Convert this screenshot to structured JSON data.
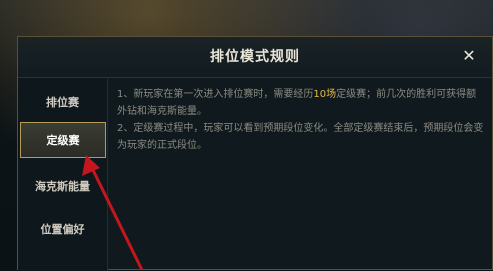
{
  "dialog": {
    "title": "排位模式规则",
    "close_glyph": "✕"
  },
  "sidebar": {
    "items": [
      {
        "label": "排位赛",
        "active": false
      },
      {
        "label": "定级赛",
        "active": true
      },
      {
        "label": "海克斯能量",
        "active": false
      },
      {
        "label": "位置偏好",
        "active": false
      }
    ]
  },
  "content": {
    "line1_prefix": "1、新玩家在第一次进入排位赛时，需要经历",
    "line1_highlight": "10场",
    "line1_suffix": "定级赛；前几次的胜利可获得额外钻和海克斯能量。",
    "line2": "2、定级赛过程中，玩家可以看到预期段位变化。全部定级赛结束后，预期段位会变为玩家的正式段位。"
  },
  "colors": {
    "highlight": "#e6b94a",
    "arrow": "#c4161c",
    "active_border": "#b89a5a"
  }
}
